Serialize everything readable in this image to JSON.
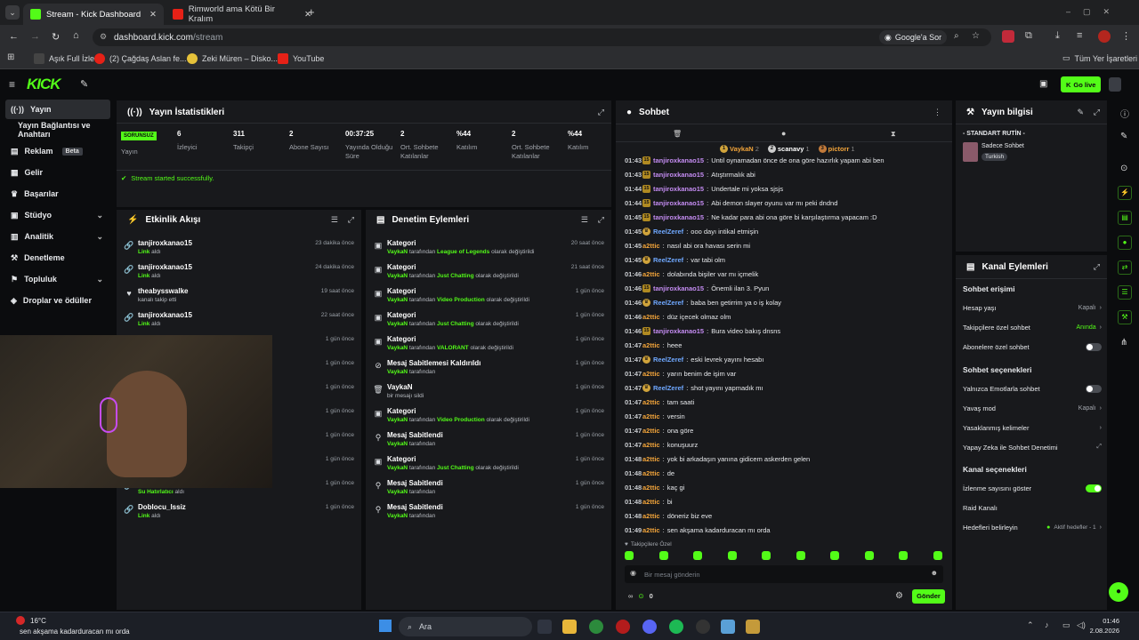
{
  "browser": {
    "tabs": [
      {
        "title": "Stream - Kick Dashboard",
        "active": true
      },
      {
        "title": "Rimworld ama Kötü Bir Kralım",
        "active": false
      }
    ],
    "url_host": "dashboard.kick.com",
    "url_path": "/stream",
    "google_lens_label": "Google'a Sor",
    "bookmarks": [
      "Aşık Full İzle",
      "(2) Çağdaş Aslan fe...",
      "Zeki Müren – Disko...",
      "YouTube"
    ],
    "all_bookmarks_label": "Tüm Yer İşaretleri"
  },
  "header": {
    "logo": "KICK",
    "go_live_label": "Go live"
  },
  "sidebar": {
    "items": [
      {
        "label": "Yayın",
        "icon": "broadcast-icon",
        "active": true
      },
      {
        "label": "Yayın Bağlantısı ve Anahtarı",
        "icon": "",
        "active": false
      },
      {
        "label": "Reklam",
        "icon": "ad-icon",
        "badge": "Beta"
      },
      {
        "label": "Gelir",
        "icon": "revenue-icon"
      },
      {
        "label": "Başarılar",
        "icon": "trophy-icon"
      },
      {
        "label": "Stüdyo",
        "icon": "studio-icon",
        "chevron": true
      },
      {
        "label": "Analitik",
        "icon": "analytics-icon",
        "chevron": true
      },
      {
        "label": "Denetleme",
        "icon": "moderation-icon"
      },
      {
        "label": "Topluluk",
        "icon": "community-icon",
        "chevron": true
      },
      {
        "label": "Droplar ve ödüller",
        "icon": "drops-icon"
      }
    ]
  },
  "stats": {
    "title": "Yayın İstatistikleri",
    "status_badge": "SORUNSUZ",
    "status_label": "Yayın",
    "items": [
      {
        "value": "6",
        "label": "İzleyici"
      },
      {
        "value": "311",
        "label": "Takipçi"
      },
      {
        "value": "2",
        "label": "Abone Sayısı"
      },
      {
        "value": "00:37:25",
        "label": "Yayında Olduğu Süre"
      },
      {
        "value": "2",
        "label": "Ort. Sohbete Katılanlar"
      },
      {
        "value": "%44",
        "label": "Katılım"
      },
      {
        "value": "2",
        "label": "Ort. Sohbete Katılanlar"
      },
      {
        "value": "%44",
        "label": "Katılım"
      }
    ],
    "success_message": "Stream started successfully."
  },
  "activity": {
    "title": "Etkinlik Akışı",
    "items": [
      {
        "user": "tanjiroxkanao15",
        "action": "Link",
        "action_suffix": " aldı",
        "time": "23 dakika önce",
        "icon": "link-icon"
      },
      {
        "user": "tanjiroxkanao15",
        "action": "Link",
        "action_suffix": " aldı",
        "time": "24 dakika önce",
        "icon": "link-icon"
      },
      {
        "user": "theabysswalke",
        "action": "",
        "action_suffix": "kanalı takip etti",
        "time": "19 saat önce",
        "icon": "heart-icon"
      },
      {
        "user": "tanjiroxkanao15",
        "action": "Link",
        "action_suffix": " aldı",
        "time": "22 saat önce",
        "icon": "link-icon"
      },
      {
        "user": "",
        "action": "",
        "action_suffix": "",
        "time": "1 gün önce",
        "icon": "link-icon"
      },
      {
        "user": "",
        "action": "",
        "action_suffix": "",
        "time": "1 gün önce",
        "icon": "link-icon"
      },
      {
        "user": "",
        "action": "",
        "action_suffix": "",
        "time": "1 gün önce",
        "icon": "link-icon"
      },
      {
        "user": "",
        "action": "",
        "action_suffix": "",
        "time": "1 gün önce",
        "icon": "link-icon"
      },
      {
        "user": "",
        "action": "",
        "action_suffix": "",
        "time": "1 gün önce",
        "icon": "link-icon"
      },
      {
        "user": "",
        "action": "",
        "action_suffix": "",
        "time": "1 gün önce",
        "icon": "link-icon"
      },
      {
        "user": "",
        "action": "Su Hatırlatıcı",
        "action_suffix": " aldı",
        "time": "1 gün önce",
        "icon": "link-icon"
      },
      {
        "user": "Doblocu_lssiz",
        "action": "Link",
        "action_suffix": " aldı",
        "time": "1 gün önce",
        "icon": "link-icon"
      }
    ]
  },
  "moderation": {
    "title": "Denetim Eylemleri",
    "items": [
      {
        "title": "Kategori",
        "actor": "VaykaN",
        "mid": " tarafından ",
        "target": "League of Legends",
        "suffix": " olarak değiştirildi",
        "time": "20 saat önce",
        "icon": "category-icon"
      },
      {
        "title": "Kategori",
        "actor": "VaykaN",
        "mid": " tarafından ",
        "target": "Just Chatting",
        "suffix": " olarak değiştirildi",
        "time": "21 saat önce",
        "icon": "category-icon"
      },
      {
        "title": "Kategori",
        "actor": "VaykaN",
        "mid": " tarafından ",
        "target": "Video Production",
        "suffix": " olarak değiştirildi",
        "time": "1 gün önce",
        "icon": "category-icon"
      },
      {
        "title": "Kategori",
        "actor": "VaykaN",
        "mid": " tarafından ",
        "target": "Just Chatting",
        "suffix": " olarak değiştirildi",
        "time": "1 gün önce",
        "icon": "category-icon"
      },
      {
        "title": "Kategori",
        "actor": "VaykaN",
        "mid": " tarafından ",
        "target": "VALORANT",
        "suffix": " olarak değiştirildi",
        "time": "1 gün önce",
        "icon": "category-icon"
      },
      {
        "title": "Mesaj Sabitlemesi Kaldırıldı",
        "actor": "VaykaN",
        "mid": " tarafından",
        "target": "",
        "suffix": "",
        "time": "1 gün önce",
        "icon": "unpin-icon"
      },
      {
        "title": "VaykaN",
        "actor": "",
        "mid": "bir mesajı sildi",
        "target": "",
        "suffix": "",
        "time": "1 gün önce",
        "icon": "trash-icon"
      },
      {
        "title": "Kategori",
        "actor": "VaykaN",
        "mid": " tarafından ",
        "target": "Video Production",
        "suffix": " olarak değiştirildi",
        "time": "1 gün önce",
        "icon": "category-icon"
      },
      {
        "title": "Mesaj Sabitlendi",
        "actor": "VaykaN",
        "mid": " tarafından",
        "target": "",
        "suffix": "",
        "time": "1 gün önce",
        "icon": "pin-icon"
      },
      {
        "title": "Kategori",
        "actor": "VaykaN",
        "mid": " tarafından ",
        "target": "Just Chatting",
        "suffix": " olarak değiştirildi",
        "time": "1 gün önce",
        "icon": "category-icon"
      },
      {
        "title": "Mesaj Sabitlendi",
        "actor": "VaykaN",
        "mid": " tarafından",
        "target": "",
        "suffix": "",
        "time": "1 gün önce",
        "icon": "pin-icon"
      },
      {
        "title": "Mesaj Sabitlendi",
        "actor": "VaykaN",
        "mid": " tarafından",
        "target": "",
        "suffix": "",
        "time": "1 gün önce",
        "icon": "pin-icon"
      }
    ]
  },
  "chat": {
    "title": "Sohbet",
    "top_users": [
      {
        "name": "VaykaN",
        "count": "2"
      },
      {
        "name": "scanavy",
        "count": "1"
      },
      {
        "name": "pictorr",
        "count": "1"
      }
    ],
    "messages": [
      {
        "time": "01:43",
        "badge": "15",
        "user": "tanjiroxkanao15",
        "color": "#c48cf2",
        "text": "Until oynamadan önce de ona göre hazırlık yapam abi ben"
      },
      {
        "time": "01:43",
        "badge": "15",
        "user": "tanjiroxkanao15",
        "color": "#c48cf2",
        "text": "Atıştırmalık abi"
      },
      {
        "time": "01:44",
        "badge": "15",
        "user": "tanjiroxkanao15",
        "color": "#c48cf2",
        "text": "Undertale mi yoksa sjsjs"
      },
      {
        "time": "01:44",
        "badge": "15",
        "user": "tanjiroxkanao15",
        "color": "#c48cf2",
        "text": "Abi demon slayer oyunu var mı peki dndnd"
      },
      {
        "time": "01:45",
        "badge": "15",
        "user": "tanjiroxkanao15",
        "color": "#c48cf2",
        "text": "Ne kadar para abi ona göre bi karşılaştırma yapacam :D"
      },
      {
        "time": "01:45",
        "badge": "R",
        "user": "ReelZeref",
        "color": "#6fa8ff",
        "text": "ooo dayı intikal etmişin"
      },
      {
        "time": "01:45",
        "badge": "",
        "user": "a2ttic",
        "color": "#f2a43a",
        "text": "nasıl abi ora havası serin mi"
      },
      {
        "time": "01:45",
        "badge": "R",
        "user": "ReelZeref",
        "color": "#6fa8ff",
        "text": "var tabi olm"
      },
      {
        "time": "01:46",
        "badge": "",
        "user": "a2ttic",
        "color": "#f2a43a",
        "text": "dolabında bişiler var mı içmelik"
      },
      {
        "time": "01:46",
        "badge": "15",
        "user": "tanjiroxkanao15",
        "color": "#c48cf2",
        "text": "Önemli ilan 3. Pyun"
      },
      {
        "time": "01:46",
        "badge": "R",
        "user": "ReelZeref",
        "color": "#6fa8ff",
        "text": "baba ben getirrim ya o iş kolay"
      },
      {
        "time": "01:46",
        "badge": "",
        "user": "a2ttic",
        "color": "#f2a43a",
        "text": "düz içecek olmaz olm"
      },
      {
        "time": "01:46",
        "badge": "15",
        "user": "tanjiroxkanao15",
        "color": "#c48cf2",
        "text": "Bura video bakış dnsns"
      },
      {
        "time": "01:47",
        "badge": "",
        "user": "a2ttic",
        "color": "#f2a43a",
        "text": "heee"
      },
      {
        "time": "01:47",
        "badge": "R",
        "user": "ReelZeref",
        "color": "#6fa8ff",
        "text": "eski levrek yayını hesabı"
      },
      {
        "time": "01:47",
        "badge": "",
        "user": "a2ttic",
        "color": "#f2a43a",
        "text": "yarın benim de işim var"
      },
      {
        "time": "01:47",
        "badge": "R",
        "user": "ReelZeref",
        "color": "#6fa8ff",
        "text": "shot yayını yapmadık mı"
      },
      {
        "time": "01:47",
        "badge": "",
        "user": "a2ttic",
        "color": "#f2a43a",
        "text": "tam saati"
      },
      {
        "time": "01:47",
        "badge": "",
        "user": "a2ttic",
        "color": "#f2a43a",
        "text": "versin"
      },
      {
        "time": "01:47",
        "badge": "",
        "user": "a2ttic",
        "color": "#f2a43a",
        "text": "ona göre"
      },
      {
        "time": "01:47",
        "badge": "",
        "user": "a2ttic",
        "color": "#f2a43a",
        "text": "konuşuurz"
      },
      {
        "time": "01:48",
        "badge": "",
        "user": "a2ttic",
        "color": "#f2a43a",
        "text": "yok bi arkadaşın yanına gidicem askerden gelen"
      },
      {
        "time": "01:48",
        "badge": "",
        "user": "a2ttic",
        "color": "#f2a43a",
        "text": "de"
      },
      {
        "time": "01:48",
        "badge": "",
        "user": "a2ttic",
        "color": "#f2a43a",
        "text": "kaç gi"
      },
      {
        "time": "01:48",
        "badge": "",
        "user": "a2ttic",
        "color": "#f2a43a",
        "text": "bi"
      },
      {
        "time": "01:48",
        "badge": "",
        "user": "a2ttic",
        "color": "#f2a43a",
        "text": "döneriz biz eve"
      },
      {
        "time": "01:49",
        "badge": "",
        "user": "a2ttic",
        "color": "#f2a43a",
        "text": "sen akşama kadarduracan mı orda"
      }
    ],
    "followers_only": "Takipçilere Özel",
    "input_placeholder": "Bir mesaj gönderin",
    "points": "0",
    "send_label": "Gönder"
  },
  "stream_info": {
    "title": "Yayın bilgisi",
    "routine": "- STANDART RUTİN -",
    "category": "Sadece Sohbet",
    "language": "Turkish"
  },
  "channel_actions": {
    "title": "Kanal Eylemleri",
    "chat_access": "Sohbet erişimi",
    "account_age": "Hesap yaşı",
    "account_age_value": "Kapalı",
    "followers_only": "Takipçilere özel sohbet",
    "followers_only_value": "Anında",
    "subs_only": "Abonelere özel sohbet",
    "chat_options": "Sohbet seçenekleri",
    "emotes_only": "Yalnızca Emotlarla sohbet",
    "slow_mode": "Yavaş mod",
    "slow_mode_value": "Kapalı",
    "banned_words": "Yasaklanmış kelimeler",
    "ai_moderation": "Yapay Zeka ile Sohbet Denetimi",
    "channel_options": "Kanal seçenekleri",
    "show_viewers": "İzlenme sayısını göster",
    "raid": "Raid Kanalı",
    "goals": "Hedefleri belirleyin",
    "goals_value": "Aktif hedefler - 1"
  },
  "taskbar": {
    "temperature": "16°C",
    "ticker": "sen akşama kadarduracan mı orda",
    "search": "Ara",
    "time": "01:46",
    "date": "2.08.2026"
  },
  "colors": {
    "accent": "#53fc18",
    "panel": "#18191c",
    "bg": "#0b0c0e"
  }
}
